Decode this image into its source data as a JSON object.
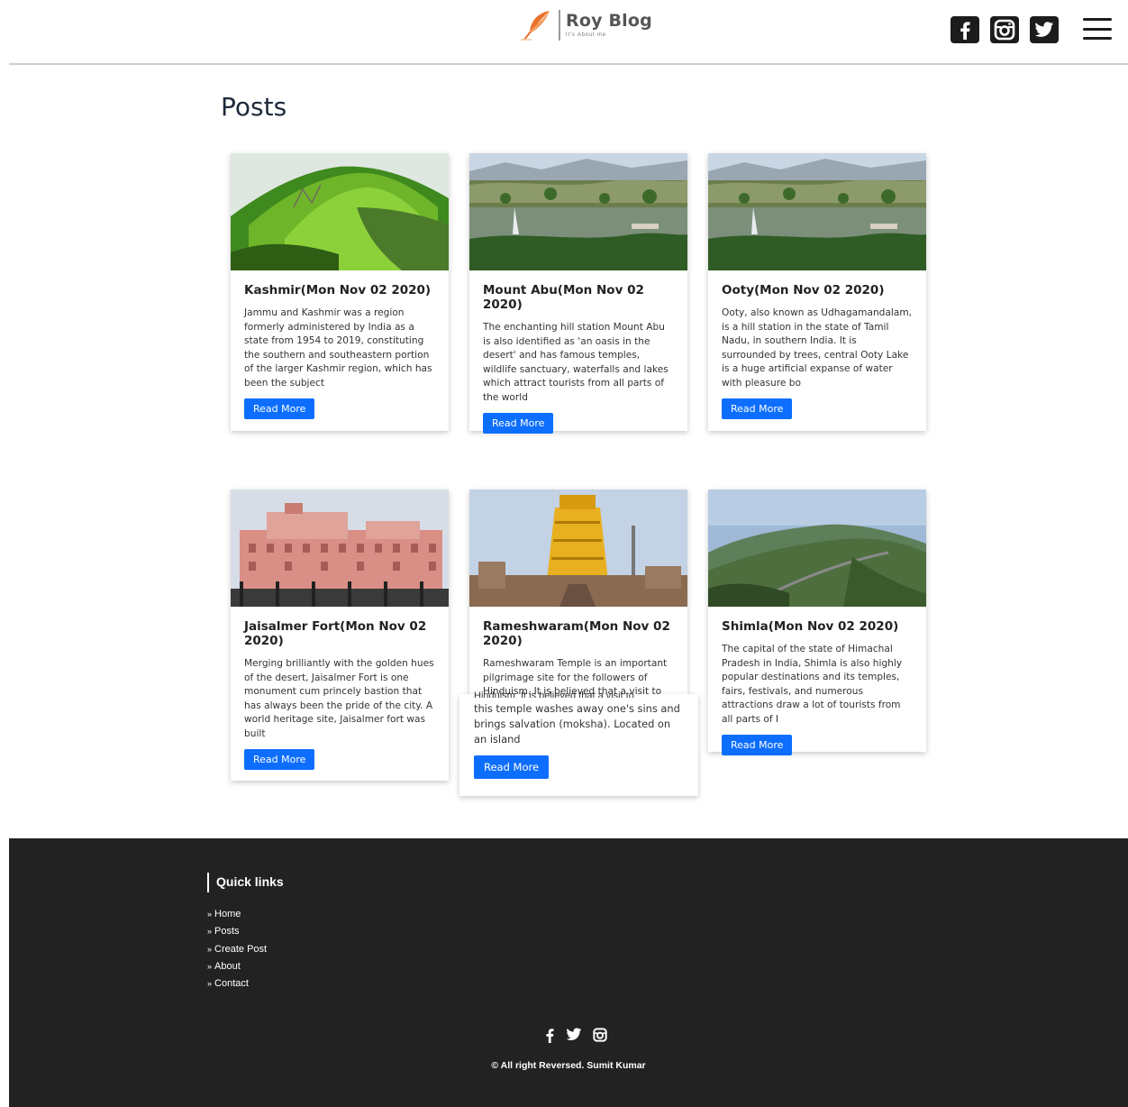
{
  "header": {
    "logo_title": "Roy Blog",
    "logo_subtitle": "It's About me",
    "social_icons": [
      "facebook-icon",
      "instagram-icon",
      "twitter-icon"
    ],
    "menu_icon": "hamburger-menu-icon"
  },
  "main": {
    "title": "Posts",
    "posts": [
      {
        "title": "Kashmir(Mon Nov 02 2020)",
        "excerpt": "Jammu and Kashmir was a region formerly administered by India as a state from 1954 to 2019, constituting the southern and southeastern portion of the larger Kashmir region, which has been the subject",
        "button": "Read More"
      },
      {
        "title": "Mount Abu(Mon Nov 02 2020)",
        "excerpt": "The enchanting hill station Mount Abu is also identified as 'an oasis in the desert' and has famous temples, wildlife sanctuary, waterfalls and lakes which attract tourists from all parts of the world",
        "button": "Read More"
      },
      {
        "title": "Ooty(Mon Nov 02 2020)",
        "excerpt": "Ooty, also known as Udhagamandalam, is a hill station in the state of Tamil Nadu, in southern India. It is surrounded by trees, central Ooty Lake is a huge artificial expanse of water with pleasure bo",
        "button": "Read More"
      },
      {
        "title": "Jaisalmer Fort(Mon Nov 02 2020)",
        "excerpt": "Merging brilliantly with the golden hues of the desert, Jaisalmer Fort is one monument cum princely bastion that has always been the pride of the city. A world heritage site, Jaisalmer fort was built",
        "button": "Read More"
      },
      {
        "title": "Rameshwaram(Mon Nov 02 2020)",
        "excerpt": "Rameshwaram Temple is an important pilgrimage site for the followers of Hinduism. It is believed that a visit to",
        "button": "Read More"
      },
      {
        "title": "Shimla(Mon Nov 02 2020)",
        "excerpt": "The capital of the state of Himachal Pradesh in India, Shimla is also highly popular destinations and its temples, fairs, festivals, and numerous attractions draw a lot of tourists from all parts of I",
        "button": "Read More"
      }
    ],
    "overflow_card": {
      "clipped_line": "Hinduism. It is believed that a visit to",
      "text": "this temple washes away one's sins and brings salvation (moksha). Located on an island",
      "button": "Read More"
    }
  },
  "footer": {
    "quick_links_title": "Quick links",
    "links": [
      "Home",
      "Posts",
      "Create Post",
      "About",
      "Contact"
    ],
    "social_icons": [
      "facebook-icon",
      "twitter-icon",
      "instagram-icon"
    ],
    "copyright": "© All right Reversed.  Sumit Kumar"
  }
}
